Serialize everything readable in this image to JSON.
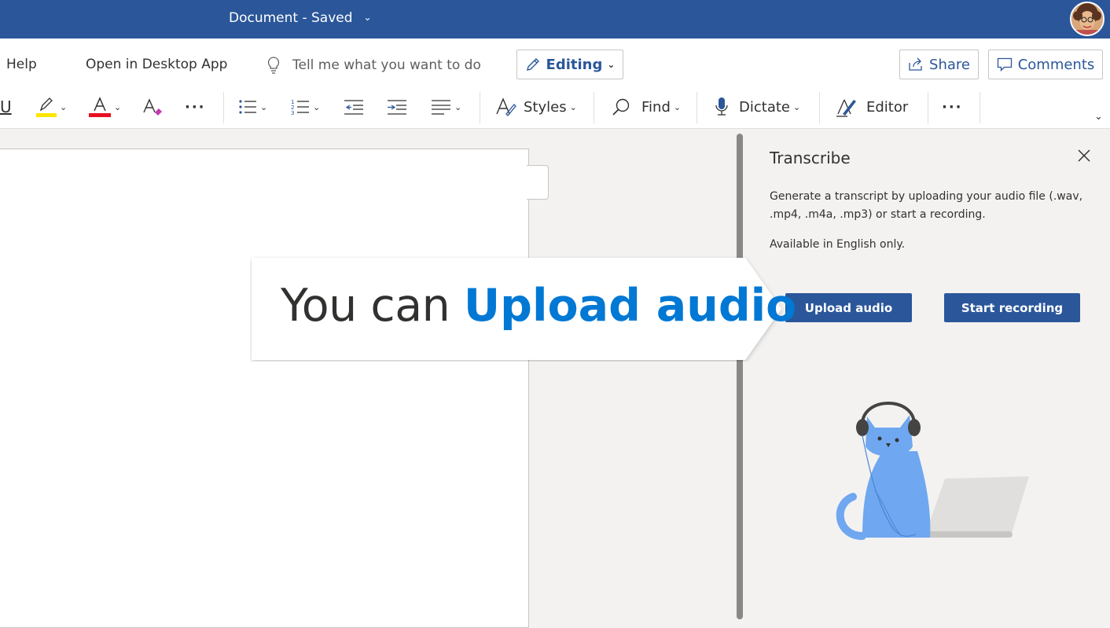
{
  "titlebar": {
    "doc_title": "Document - Saved",
    "chevron_icon": "chevron-down-icon",
    "avatar_icon": "user-avatar"
  },
  "menubar": {
    "help_label": "Help",
    "open_desktop_label": "Open in Desktop App",
    "tellme_placeholder": "Tell me what you want to do",
    "editing_label": "Editing",
    "share_label": "Share",
    "comments_label": "Comments"
  },
  "ribbon": {
    "styles_label": "Styles",
    "find_label": "Find",
    "dictate_label": "Dictate",
    "editor_label": "Editor",
    "more_label": "···",
    "highlight_color": "#ffe600",
    "font_color": "#e81123"
  },
  "pane": {
    "title": "Transcribe",
    "description": "Generate a transcript by uploading your audio file (.wav, .mp4, .m4a, .mp3) or start a recording.",
    "note": "Available in English only.",
    "upload_label": "Upload audio",
    "record_label": "Start recording"
  },
  "callout": {
    "prefix": "You can ",
    "highlight": "Upload audio"
  },
  "colors": {
    "brand": "#2b579a",
    "accent": "#0078d4"
  }
}
